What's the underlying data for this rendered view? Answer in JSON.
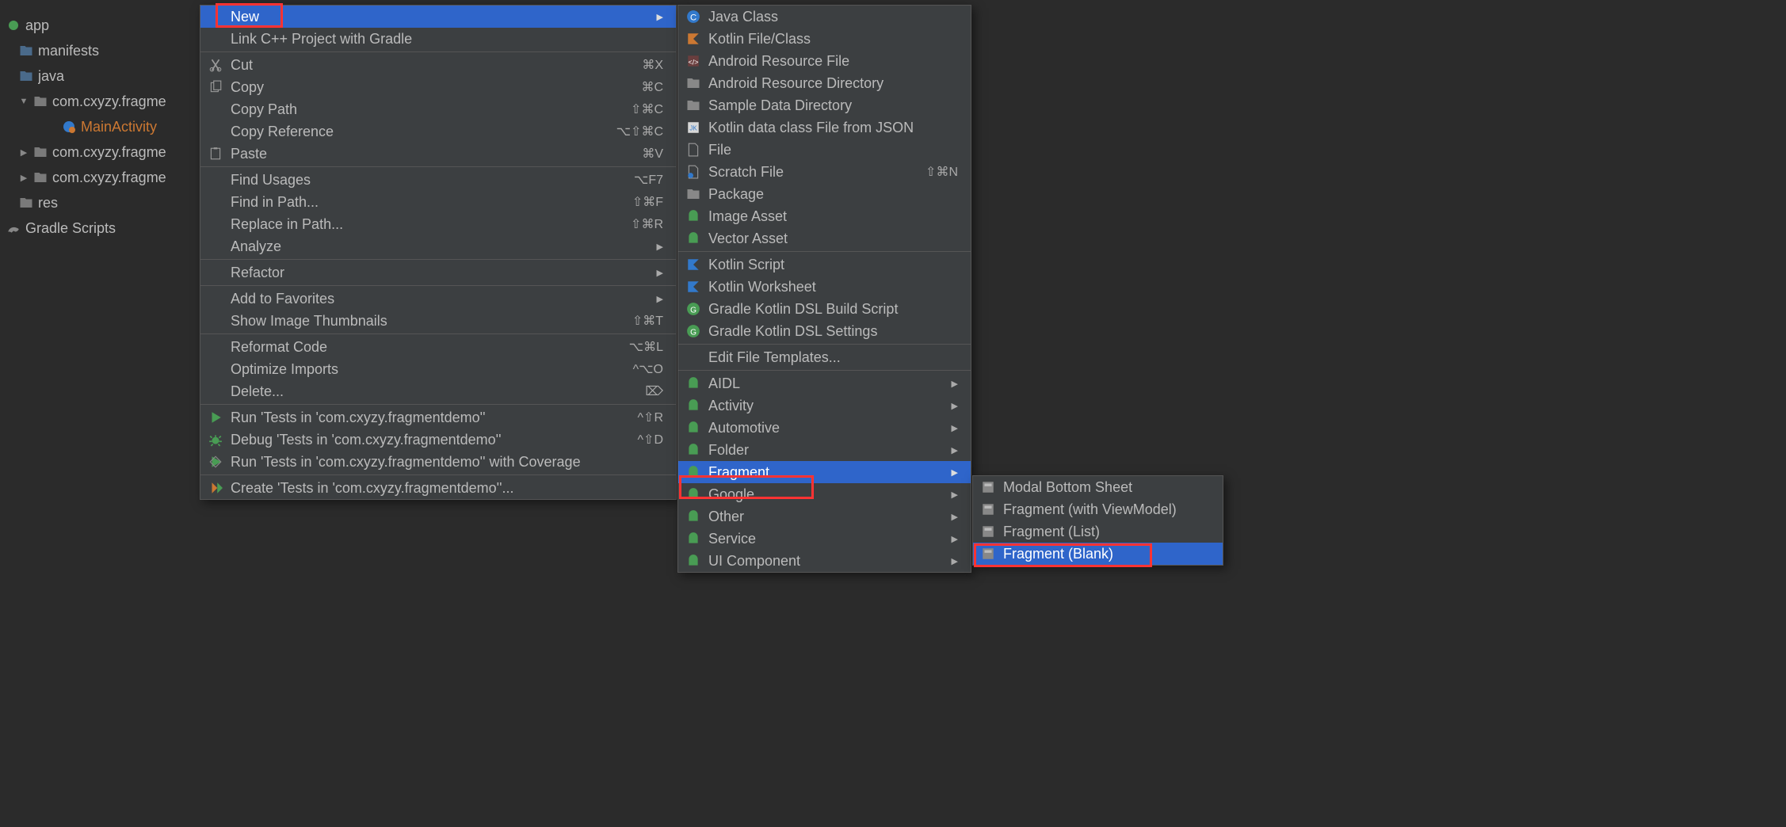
{
  "tree": {
    "app": "app",
    "manifests": "manifests",
    "java": "java",
    "pkg1": "com.cxyzy.fragme",
    "mainActivity": "MainActivity",
    "pkg2": "com.cxyzy.fragme",
    "pkg3": "com.cxyzy.fragme",
    "res": "res",
    "gradle": "Gradle Scripts"
  },
  "context": {
    "new": {
      "label": "New"
    },
    "link_cpp": {
      "label": "Link C++ Project with Gradle"
    },
    "cut": {
      "label": "Cut",
      "shortcut": "⌘X"
    },
    "copy": {
      "label": "Copy",
      "shortcut": "⌘C"
    },
    "copy_path": {
      "label": "Copy Path",
      "shortcut": "⇧⌘C"
    },
    "copy_reference": {
      "label": "Copy Reference",
      "shortcut": "⌥⇧⌘C"
    },
    "paste": {
      "label": "Paste",
      "shortcut": "⌘V"
    },
    "find_usages": {
      "label": "Find Usages",
      "shortcut": "⌥F7"
    },
    "find_in_path": {
      "label": "Find in Path...",
      "shortcut": "⇧⌘F"
    },
    "replace_in_path": {
      "label": "Replace in Path...",
      "shortcut": "⇧⌘R"
    },
    "analyze": {
      "label": "Analyze"
    },
    "refactor": {
      "label": "Refactor"
    },
    "add_favorites": {
      "label": "Add to Favorites"
    },
    "show_thumbnails": {
      "label": "Show Image Thumbnails",
      "shortcut": "⇧⌘T"
    },
    "reformat": {
      "label": "Reformat Code",
      "shortcut": "⌥⌘L"
    },
    "optimize": {
      "label": "Optimize Imports",
      "shortcut": "^⌥O"
    },
    "delete": {
      "label": "Delete...",
      "shortcut": "⌦"
    },
    "run_tests": {
      "label": "Run 'Tests in 'com.cxyzy.fragmentdemo''",
      "shortcut": "^⇧R"
    },
    "debug_tests": {
      "label": "Debug 'Tests in 'com.cxyzy.fragmentdemo''",
      "shortcut": "^⇧D"
    },
    "run_coverage": {
      "label": "Run 'Tests in 'com.cxyzy.fragmentdemo'' with Coverage"
    },
    "create_tests": {
      "label": "Create 'Tests in 'com.cxyzy.fragmentdemo''..."
    }
  },
  "new_menu": {
    "java_class": {
      "label": "Java Class"
    },
    "kotlin_file": {
      "label": "Kotlin File/Class"
    },
    "resource_file": {
      "label": "Android Resource File"
    },
    "resource_dir": {
      "label": "Android Resource Directory"
    },
    "sample_data": {
      "label": "Sample Data Directory"
    },
    "kotlin_json": {
      "label": "Kotlin data class File from JSON"
    },
    "file": {
      "label": "File"
    },
    "scratch": {
      "label": "Scratch File",
      "shortcut": "⇧⌘N"
    },
    "package": {
      "label": "Package"
    },
    "image_asset": {
      "label": "Image Asset"
    },
    "vector_asset": {
      "label": "Vector Asset"
    },
    "kotlin_script": {
      "label": "Kotlin Script"
    },
    "kotlin_worksheet": {
      "label": "Kotlin Worksheet"
    },
    "gradle_build": {
      "label": "Gradle Kotlin DSL Build Script"
    },
    "gradle_settings": {
      "label": "Gradle Kotlin DSL Settings"
    },
    "edit_templates": {
      "label": "Edit File Templates..."
    },
    "aidl": {
      "label": "AIDL"
    },
    "activity": {
      "label": "Activity"
    },
    "automotive": {
      "label": "Automotive"
    },
    "folder": {
      "label": "Folder"
    },
    "fragment": {
      "label": "Fragment"
    },
    "google": {
      "label": "Google"
    },
    "other": {
      "label": "Other"
    },
    "service": {
      "label": "Service"
    },
    "ui_component": {
      "label": "UI Component"
    }
  },
  "fragment_menu": {
    "modal": {
      "label": "Modal Bottom Sheet"
    },
    "viewmodel": {
      "label": "Fragment (with ViewModel)"
    },
    "list": {
      "label": "Fragment (List)"
    },
    "blank": {
      "label": "Fragment (Blank)"
    }
  }
}
